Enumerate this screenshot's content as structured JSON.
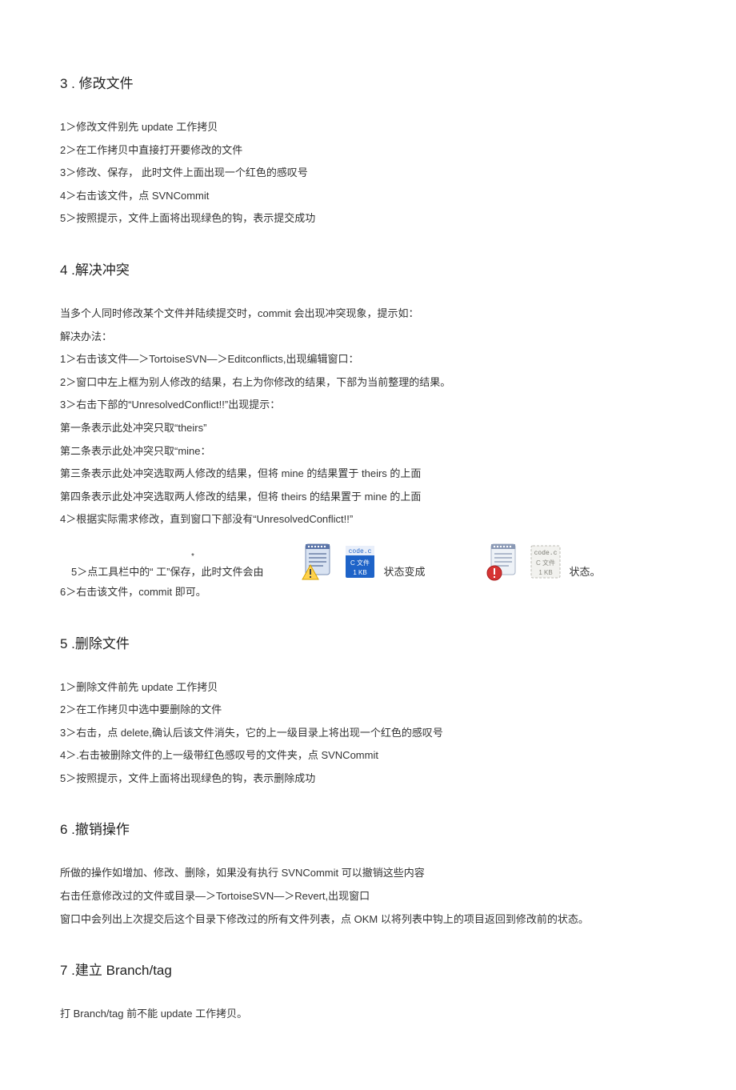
{
  "sections": {
    "s3": {
      "title": "3 . 修改文件",
      "lines": [
        "1＞修改文件别先 update 工作拷贝",
        "2＞在工作拷贝中直接打开要修改的文件",
        "3＞修改、保存，  此时文件上面出现一个红色的感叹号",
        "4＞右击该文件，点 SVNCommit",
        "5＞按照提示，文件上面将出现绿色的钩，表示提交成功"
      ]
    },
    "s4": {
      "title": "4 .解决冲突",
      "lines": [
        "当多个人同时修改某个文件并陆续提交时，commit 会出现冲突现象，提示如：",
        "解决办法：",
        "1＞右击该文件—＞TortoiseSVN—＞Editconflicts,出现编辑窗口：",
        "2＞窗口中左上框为别人修改的结果，右上为你修改的结果，下部为当前整理的结果。",
        "3＞右击下部的“UnresolvedConflict!!”出现提示：",
        "第一条表示此处冲突只取“theirs”",
        "第二条表示此处冲突只取“mine：",
        "第三条表示此处冲突选取两人修改的结果，但将 mine 的结果置于 theirs 的上面",
        "第四条表示此处冲突选取两人修改的结果，但将 theirs 的结果置于 mine 的上面",
        "4＞根据实际需求修改，直到窗口下部没有“UnresolvedConflict!!”"
      ],
      "iconrow": {
        "t1": "5＞点工具栏中的“ 工”保存，此时文件会由",
        "t2": "状态变成",
        "t3": "状态。"
      },
      "line6": "6＞右击该文件，commit 即可。"
    },
    "s5": {
      "title": "5 .删除文件",
      "lines": [
        "1＞删除文件前先 update 工作拷贝",
        "2＞在工作拷贝中选中要删除的文件",
        "3＞右击，点 delete,确认后该文件消失，它的上一级目录上将出现一个红色的感叹号",
        "4＞.右击被删除文件的上一级带红色感叹号的文件夹，点 SVNCommit",
        "5＞按照提示，文件上面将出现绿色的钩，表示删除成功"
      ]
    },
    "s6": {
      "title": "6 .撤销操作",
      "lines": [
        "所做的操作如增加、修改、删除，如果没有执行 SVNCommit 可以撤销这些内容",
        "右击任意修改过的文件或目录—＞TortoiseSVN—＞Revert,出现窗口",
        "窗口中会列出上次提交后这个目录下修改过的所有文件列表，点 OKM 以将列表中钩上的项目返回到修改前的状态。"
      ]
    },
    "s7": {
      "title": "7 .建立 Branch/tag",
      "lines": [
        "打 Branch/tag 前不能 update 工作拷贝。"
      ]
    }
  }
}
